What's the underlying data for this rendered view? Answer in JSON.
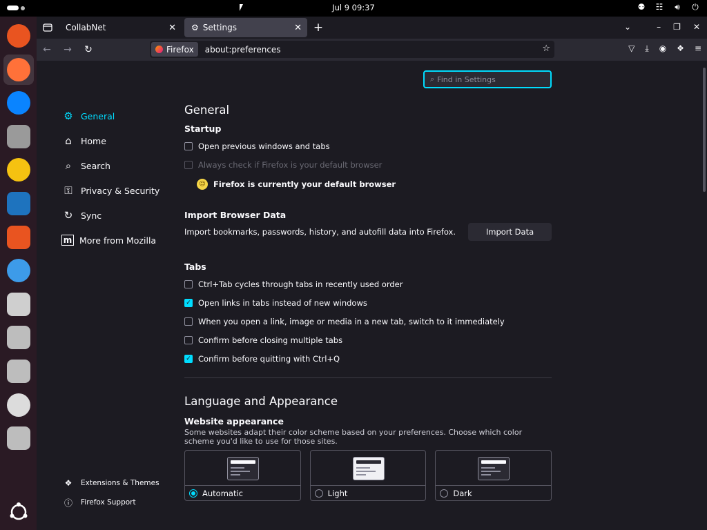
{
  "topbar": {
    "clock": "Jul 9  09:37",
    "tray_icons": [
      "accessibility-icon",
      "network-icon",
      "volume-icon",
      "power-icon"
    ]
  },
  "dock": {
    "items": [
      {
        "name": "help-icon-top",
        "color": "#e95420"
      },
      {
        "name": "firefox-icon",
        "color": "#ff7139"
      },
      {
        "name": "thunderbird-icon",
        "color": "#0a84ff"
      },
      {
        "name": "files-icon",
        "color": "#9a9a9a"
      },
      {
        "name": "rhythmbox-icon",
        "color": "#f5c211"
      },
      {
        "name": "writer-icon",
        "color": "#1e73be"
      },
      {
        "name": "app-center-icon",
        "color": "#e95420"
      },
      {
        "name": "help-icon",
        "color": "#3d9be9"
      },
      {
        "name": "save-disk-icon",
        "color": "#cfcfcf"
      },
      {
        "name": "drive-icon",
        "color": "#bdbdbd"
      },
      {
        "name": "drive-icon-2",
        "color": "#bdbdbd"
      },
      {
        "name": "disc-icon",
        "color": "#dcdcdc"
      },
      {
        "name": "trash-icon",
        "color": "#bdbdbd"
      }
    ]
  },
  "browser": {
    "tabs": [
      {
        "label": "CollabNet",
        "selected": false
      },
      {
        "label": "Settings",
        "selected": true
      }
    ],
    "identity_label": "Firefox",
    "url": "about:preferences"
  },
  "prefs": {
    "search_placeholder": "Find in Settings",
    "categories": [
      {
        "label": "General",
        "icon": "gear-icon",
        "selected": true
      },
      {
        "label": "Home",
        "icon": "home-icon",
        "selected": false
      },
      {
        "label": "Search",
        "icon": "search-icon",
        "selected": false
      },
      {
        "label": "Privacy & Security",
        "icon": "lock-icon",
        "selected": false
      },
      {
        "label": "Sync",
        "icon": "sync-icon",
        "selected": false
      },
      {
        "label": "More from Mozilla",
        "icon": "mozilla-icon",
        "selected": false
      }
    ],
    "footer_links": [
      {
        "label": "Extensions & Themes",
        "icon": "puzzle-icon"
      },
      {
        "label": "Firefox Support",
        "icon": "help-circle-icon"
      }
    ],
    "general_title": "General",
    "startup": {
      "heading": "Startup",
      "open_previous": {
        "label": "Open previous windows and tabs",
        "checked": false
      },
      "always_check": {
        "label": "Always check if Firefox is your default browser",
        "checked": false,
        "disabled": true
      },
      "default_note": "Firefox is currently your default browser"
    },
    "import": {
      "heading": "Import Browser Data",
      "description": "Import bookmarks, passwords, history, and autofill data into Firefox.",
      "button": "Import Data"
    },
    "tabs": {
      "heading": "Tabs",
      "options": [
        {
          "label": "Ctrl+Tab cycles through tabs in recently used order",
          "checked": false
        },
        {
          "label": "Open links in tabs instead of new windows",
          "checked": true
        },
        {
          "label": "When you open a link, image or media in a new tab, switch to it immediately",
          "checked": false
        },
        {
          "label": "Confirm before closing multiple tabs",
          "checked": false
        },
        {
          "label": "Confirm before quitting with Ctrl+Q",
          "checked": true
        }
      ]
    },
    "language": {
      "title": "Language and Appearance",
      "website_appearance": "Website appearance",
      "description": "Some websites adapt their color scheme based on your preferences. Choose which color scheme you'd like to use for those sites.",
      "themes": [
        {
          "label": "Automatic",
          "selected": true,
          "style": "dark"
        },
        {
          "label": "Light",
          "selected": false,
          "style": "light"
        },
        {
          "label": "Dark",
          "selected": false,
          "style": "dark"
        }
      ]
    }
  },
  "colors": {
    "accent": "#00ddff",
    "background": "#1c1b22"
  }
}
